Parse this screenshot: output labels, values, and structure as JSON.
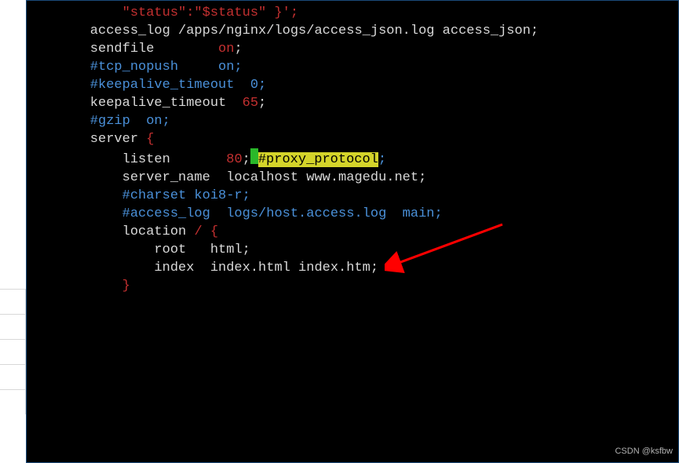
{
  "lines": {
    "l1a": "        \"status\":\"$status\" }';",
    "l1": "    access_log /apps/nginx/logs/access_json.log access_json;",
    "l2": "",
    "l3": "",
    "l4": "",
    "s1a": "    sendfile        ",
    "s1b": "on",
    "s1c": ";",
    "s2": "    #tcp_nopush     on;",
    "s3": "",
    "s4": "    #keepalive_timeout  0;",
    "s5a": "    keepalive_timeout  ",
    "s5b": "65",
    "s5c": ";",
    "s6": "",
    "s7": "    #gzip  on;",
    "s8": "",
    "s9a": "    server ",
    "s9b": "{",
    "s10a": "        listen       ",
    "s10b": "80",
    "s10c": ";",
    "s10d": "#proxy_protocol",
    "s10e": ";",
    "s11": "        server_name  localhost www.magedu.net;",
    "s12": "",
    "s13": "        #charset koi8-r;",
    "s14": "",
    "s15": "        #access_log  logs/host.access.log  main;",
    "s16": "",
    "s17a": "        location ",
    "s17b": "/ {",
    "s18": "            root   html;",
    "s19": "            index  index.html index.htm;",
    "s20a": "        ",
    "s20b": "}"
  },
  "watermark": "CSDN @ksfbw"
}
